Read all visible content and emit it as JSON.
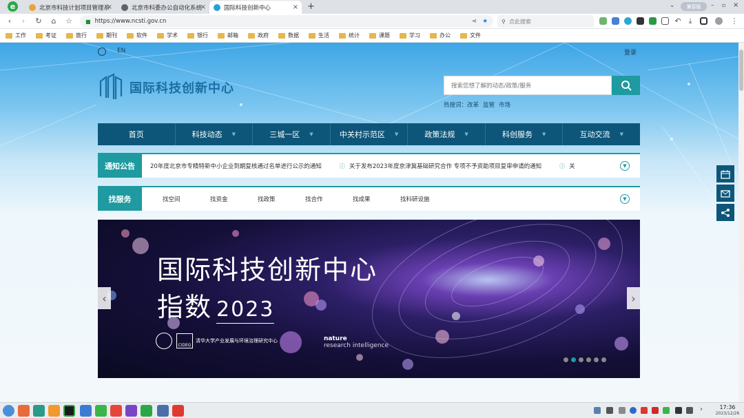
{
  "browser": {
    "tabs": [
      {
        "title": "北京市科技计划项目管理系",
        "active": false,
        "favicon_color": "#e8a33a"
      },
      {
        "title": "北京市科委办公自动化系统",
        "active": false,
        "favicon_color": "#5f6368"
      },
      {
        "title": "国际科技创新中心",
        "active": true,
        "favicon_color": "#2a9fd6"
      }
    ],
    "url": "https://www.ncsti.gov.cn",
    "search_placeholder": "点此搜索",
    "mode_badge": "兼容版",
    "bookmarks": [
      "工作",
      "考证",
      "旅行",
      "期刊",
      "软件",
      "学术",
      "银行",
      "邮箱",
      "政府",
      "数据",
      "生活",
      "统计",
      "课题",
      "学习",
      "办公",
      "文件"
    ]
  },
  "site": {
    "lang_label": "EN",
    "login_label": "登录",
    "logo_text": "国际科技创新中心",
    "search_placeholder": "搜索您想了解的动态/政策/服务",
    "hot_label": "热搜词：",
    "hot_words": [
      "改革",
      "监管",
      "市场"
    ],
    "nav": [
      {
        "label": "首页",
        "has_menu": false
      },
      {
        "label": "科技动态",
        "has_menu": true
      },
      {
        "label": "三城一区",
        "has_menu": true
      },
      {
        "label": "中关村示范区",
        "has_menu": true
      },
      {
        "label": "政策法规",
        "has_menu": true
      },
      {
        "label": "科创服务",
        "has_menu": true
      },
      {
        "label": "互动交流",
        "has_menu": true
      }
    ],
    "notice": {
      "label": "通知公告",
      "items": [
        "20年度北京市专精特新中小企业到期复核通过名单进行公示的通知",
        "关于发布2023年度京津冀基础研究合作 专项不予资助项目复审申请的通知",
        "关"
      ]
    },
    "service": {
      "label": "找服务",
      "items": [
        "找空间",
        "找资金",
        "找政策",
        "找合作",
        "找成果",
        "找科研设施"
      ]
    },
    "banner": {
      "title_line1": "国际科技创新中心",
      "title_line2": "指数",
      "year": "2023",
      "logo1": "清华大学产业发展与环境治理研究中心",
      "logo1_sub": "CIDEG",
      "logo2_top": "nature",
      "logo2_bottom": "research intelligence",
      "slides": 6,
      "current_slide": 2
    }
  },
  "taskbar": {
    "time": "17:36",
    "date": "2023/12/26"
  }
}
